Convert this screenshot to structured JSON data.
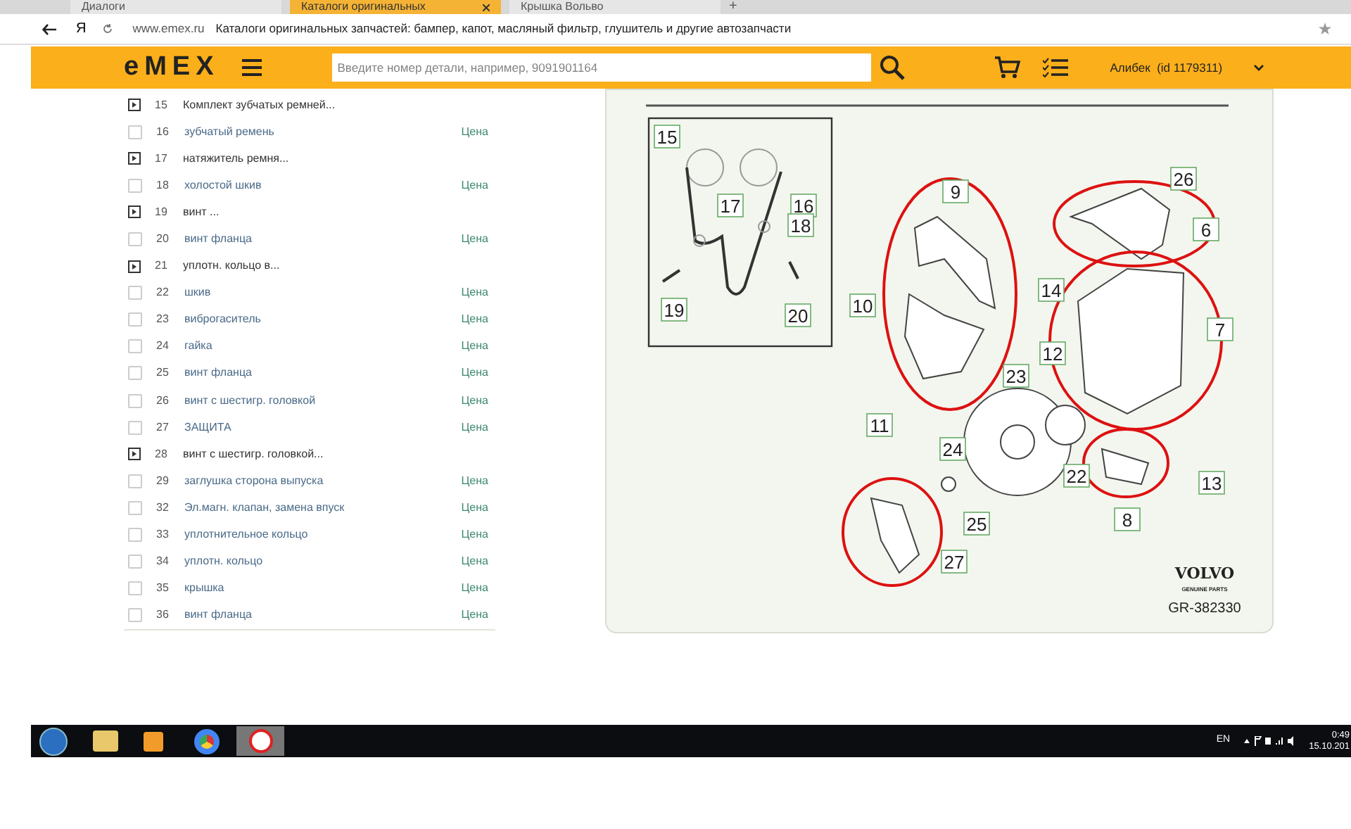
{
  "browser": {
    "tabs": [
      {
        "label": "Диалоги",
        "selected": false,
        "closable": false
      },
      {
        "label": "Каталоги оригинальных",
        "selected": true,
        "closable": true
      },
      {
        "label": "Крышка Вольво",
        "selected": false,
        "closable": false
      }
    ],
    "new_tab": "+",
    "logo_letter": "Я",
    "url": "www.emex.ru",
    "page_title": "Каталоги оригинальных запчастей: бампер, капот, масляный фильтр, глушитель и другие автозапчасти"
  },
  "header": {
    "logo": "eMEX",
    "search": {
      "placeholder": "Введите номер детали, например, 9091901164"
    },
    "user": "Алибек  (id 1179311)"
  },
  "parts": [
    {
      "kind": "group",
      "number": "15",
      "name": "Комплект зубчатых ремней..."
    },
    {
      "kind": "part",
      "number": "16",
      "name": "зубчатый ремень",
      "price": "Цена",
      "checked": false
    },
    {
      "kind": "group",
      "number": "17",
      "name": "натяжитель ремня..."
    },
    {
      "kind": "part",
      "number": "18",
      "name": "холостой шкив",
      "price": "Цена",
      "checked": false
    },
    {
      "kind": "group",
      "number": "19",
      "name": "винт ..."
    },
    {
      "kind": "part",
      "number": "20",
      "name": "винт фланца",
      "price": "Цена",
      "checked": false
    },
    {
      "kind": "group",
      "number": "21",
      "name": "уплотн. кольцо в..."
    },
    {
      "kind": "part",
      "number": "22",
      "name": "шкив",
      "price": "Цена",
      "checked": false
    },
    {
      "kind": "part",
      "number": "23",
      "name": "виброгаситель",
      "price": "Цена",
      "checked": false
    },
    {
      "kind": "part",
      "number": "24",
      "name": "гайка",
      "price": "Цена",
      "checked": false
    },
    {
      "kind": "part",
      "number": "25",
      "name": "винт фланца",
      "price": "Цена",
      "checked": false
    },
    {
      "kind": "part",
      "number": "26",
      "name": "винт с шестигр. головкой",
      "price": "Цена",
      "checked": false
    },
    {
      "kind": "part",
      "number": "27",
      "name": "ЗАЩИТА",
      "price": "Цена",
      "checked": false
    },
    {
      "kind": "group",
      "number": "28",
      "name": "винт с шестигр. головкой..."
    },
    {
      "kind": "part",
      "number": "29",
      "name": "заглушка сторона выпуска",
      "price": "Цена",
      "checked": false
    },
    {
      "kind": "part",
      "number": "32",
      "name": "Эл.магн. клапан, замена впуск",
      "price": "Цена",
      "checked": false
    },
    {
      "kind": "part",
      "number": "33",
      "name": "уплотнительное кольцо",
      "price": "Цена",
      "checked": false
    },
    {
      "kind": "part",
      "number": "34",
      "name": "уплотн. кольцо",
      "price": "Цена",
      "checked": false
    },
    {
      "kind": "part",
      "number": "35",
      "name": "крышка",
      "price": "Цена",
      "checked": false
    },
    {
      "kind": "part",
      "number": "36",
      "name": "винт фланца",
      "price": "Цена",
      "checked": false
    }
  ],
  "diagram": {
    "callouts": [
      "15",
      "17",
      "16",
      "18",
      "19",
      "20",
      "9",
      "10",
      "26",
      "6",
      "14",
      "12",
      "7",
      "23",
      "11",
      "24",
      "22",
      "13",
      "8",
      "25",
      "27"
    ],
    "brand": "VOLVO",
    "brand_subtitle": "GENUINE PARTS",
    "code": "GR-382330"
  },
  "taskbar": {
    "language": "EN",
    "time": "0:49",
    "date": "15.10.201"
  }
}
